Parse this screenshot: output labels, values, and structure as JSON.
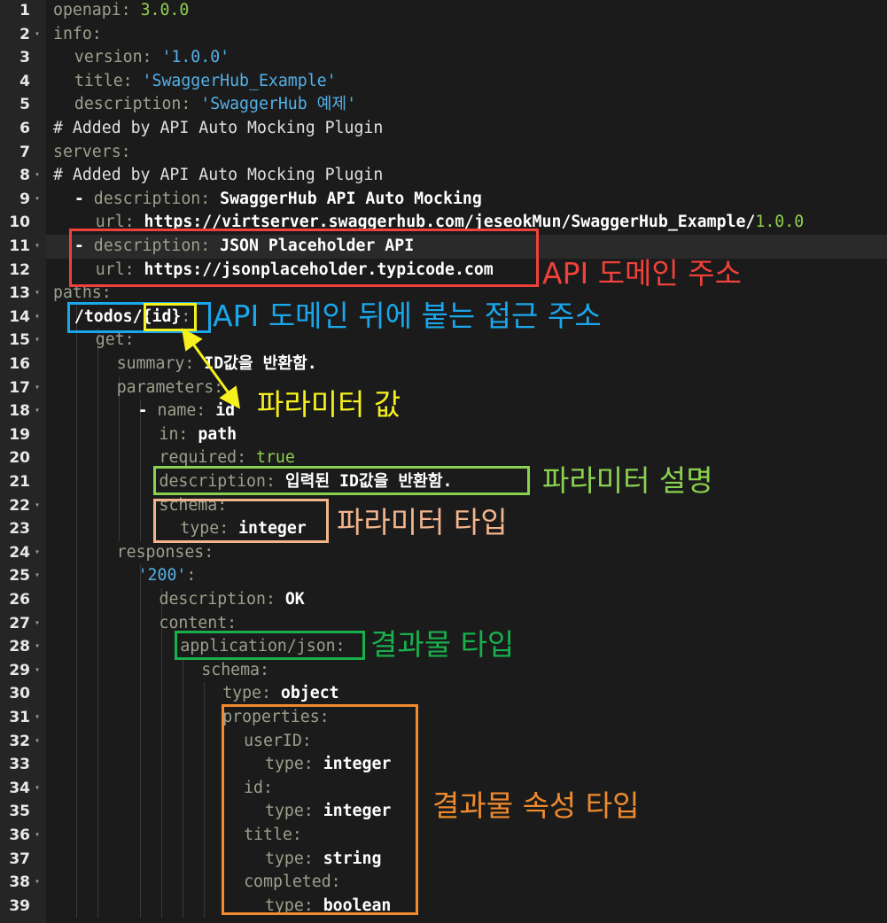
{
  "editor": {
    "lines": [
      {
        "n": "1",
        "indent": 0,
        "fold": false,
        "tokens": [
          [
            "k",
            "openapi: "
          ],
          [
            "n",
            "3.0.0"
          ]
        ]
      },
      {
        "n": "2",
        "indent": 0,
        "fold": true,
        "tokens": [
          [
            "k",
            "info:"
          ]
        ]
      },
      {
        "n": "3",
        "indent": 1,
        "fold": false,
        "tokens": [
          [
            "k",
            "version: "
          ],
          [
            "s",
            "'1.0.0'"
          ]
        ]
      },
      {
        "n": "4",
        "indent": 1,
        "fold": false,
        "tokens": [
          [
            "k",
            "title: "
          ],
          [
            "s",
            "'SwaggerHub_Example'"
          ]
        ]
      },
      {
        "n": "5",
        "indent": 1,
        "fold": false,
        "tokens": [
          [
            "k",
            "description: "
          ],
          [
            "s",
            "'SwaggerHub 예제'"
          ]
        ]
      },
      {
        "n": "6",
        "indent": 0,
        "fold": false,
        "tokens": [
          [
            "c",
            "# Added by API Auto Mocking Plugin"
          ]
        ]
      },
      {
        "n": "7",
        "indent": 0,
        "fold": false,
        "tokens": [
          [
            "k",
            "servers:"
          ]
        ]
      },
      {
        "n": "8",
        "indent": 0,
        "fold": true,
        "tokens": [
          [
            "c",
            "# Added by API Auto Mocking Plugin"
          ]
        ]
      },
      {
        "n": "9",
        "indent": 1,
        "fold": true,
        "tokens": [
          [
            "v",
            "- "
          ],
          [
            "k",
            "description: "
          ],
          [
            "v",
            "SwaggerHub API Auto Mocking"
          ]
        ]
      },
      {
        "n": "10",
        "indent": 2,
        "fold": false,
        "tokens": [
          [
            "k",
            "url: "
          ],
          [
            "v",
            "https://virtserver.swaggerhub.com/jeseokMun/SwaggerHub_Example/"
          ],
          [
            "n",
            "1.0.0"
          ]
        ]
      },
      {
        "n": "11",
        "indent": 1,
        "fold": true,
        "tokens": [
          [
            "v",
            "- "
          ],
          [
            "k",
            "description: "
          ],
          [
            "v",
            "JSON Placeholder API"
          ]
        ]
      },
      {
        "n": "12",
        "indent": 2,
        "fold": false,
        "tokens": [
          [
            "k",
            "url: "
          ],
          [
            "v",
            "https://jsonplaceholder.typicode.com"
          ]
        ]
      },
      {
        "n": "13",
        "indent": 0,
        "fold": true,
        "tokens": [
          [
            "k",
            "paths:"
          ]
        ]
      },
      {
        "n": "14",
        "indent": 1,
        "fold": true,
        "tokens": [
          [
            "v",
            "/todos/{id}"
          ],
          [
            "k",
            ":"
          ]
        ]
      },
      {
        "n": "15",
        "indent": 2,
        "fold": true,
        "tokens": [
          [
            "k",
            "get:"
          ]
        ]
      },
      {
        "n": "16",
        "indent": 3,
        "fold": false,
        "tokens": [
          [
            "k",
            "summary: "
          ],
          [
            "v",
            "ID값을 반환함."
          ]
        ]
      },
      {
        "n": "17",
        "indent": 3,
        "fold": true,
        "tokens": [
          [
            "k",
            "parameters:"
          ]
        ]
      },
      {
        "n": "18",
        "indent": 4,
        "fold": true,
        "tokens": [
          [
            "v",
            "- "
          ],
          [
            "k",
            "name: "
          ],
          [
            "v",
            "id"
          ]
        ]
      },
      {
        "n": "19",
        "indent": 5,
        "fold": false,
        "tokens": [
          [
            "k",
            "in: "
          ],
          [
            "v",
            "path"
          ]
        ]
      },
      {
        "n": "20",
        "indent": 5,
        "fold": false,
        "tokens": [
          [
            "k",
            "required: "
          ],
          [
            "n",
            "true"
          ]
        ]
      },
      {
        "n": "21",
        "indent": 5,
        "fold": false,
        "tokens": [
          [
            "k",
            "description: "
          ],
          [
            "v",
            "입력된 ID값을 반환함."
          ]
        ]
      },
      {
        "n": "22",
        "indent": 5,
        "fold": true,
        "tokens": [
          [
            "k",
            "schema:"
          ]
        ]
      },
      {
        "n": "23",
        "indent": 6,
        "fold": false,
        "tokens": [
          [
            "k",
            "type: "
          ],
          [
            "v",
            "integer"
          ]
        ]
      },
      {
        "n": "24",
        "indent": 3,
        "fold": true,
        "tokens": [
          [
            "k",
            "responses:"
          ]
        ]
      },
      {
        "n": "25",
        "indent": 4,
        "fold": true,
        "tokens": [
          [
            "s",
            "'200'"
          ],
          [
            "k",
            ":"
          ]
        ]
      },
      {
        "n": "26",
        "indent": 5,
        "fold": false,
        "tokens": [
          [
            "k",
            "description: "
          ],
          [
            "v",
            "OK"
          ]
        ]
      },
      {
        "n": "27",
        "indent": 5,
        "fold": true,
        "tokens": [
          [
            "k",
            "content:"
          ]
        ]
      },
      {
        "n": "28",
        "indent": 6,
        "fold": true,
        "tokens": [
          [
            "k",
            "application/json:"
          ]
        ]
      },
      {
        "n": "29",
        "indent": 7,
        "fold": true,
        "tokens": [
          [
            "k",
            "schema:"
          ]
        ]
      },
      {
        "n": "30",
        "indent": 8,
        "fold": false,
        "tokens": [
          [
            "k",
            "type: "
          ],
          [
            "v",
            "object"
          ]
        ]
      },
      {
        "n": "31",
        "indent": 8,
        "fold": true,
        "tokens": [
          [
            "k",
            "properties:"
          ]
        ]
      },
      {
        "n": "32",
        "indent": 9,
        "fold": true,
        "tokens": [
          [
            "k",
            "userID:"
          ]
        ]
      },
      {
        "n": "33",
        "indent": 10,
        "fold": false,
        "tokens": [
          [
            "k",
            "type: "
          ],
          [
            "v",
            "integer"
          ]
        ]
      },
      {
        "n": "34",
        "indent": 9,
        "fold": true,
        "tokens": [
          [
            "k",
            "id:"
          ]
        ]
      },
      {
        "n": "35",
        "indent": 10,
        "fold": false,
        "tokens": [
          [
            "k",
            "type: "
          ],
          [
            "v",
            "integer"
          ]
        ]
      },
      {
        "n": "36",
        "indent": 9,
        "fold": true,
        "tokens": [
          [
            "k",
            "title:"
          ]
        ]
      },
      {
        "n": "37",
        "indent": 10,
        "fold": false,
        "tokens": [
          [
            "k",
            "type: "
          ],
          [
            "v",
            "string"
          ]
        ]
      },
      {
        "n": "38",
        "indent": 9,
        "fold": true,
        "tokens": [
          [
            "k",
            "completed:"
          ]
        ]
      },
      {
        "n": "39",
        "indent": 10,
        "fold": false,
        "tokens": [
          [
            "k",
            "type: "
          ],
          [
            "v",
            "boolean"
          ]
        ]
      }
    ],
    "active_line": "11"
  },
  "annotations": {
    "domain_address": {
      "text": "API 도메인 주소",
      "color": "#f0413a"
    },
    "path_address": {
      "text": "API 도메인 뒤에 붙는 접근 주소",
      "color": "#1aa7ec"
    },
    "param_value": {
      "text": "파라미터 값",
      "color": "#f5f01e"
    },
    "param_desc": {
      "text": "파라미터 설명",
      "color": "#8ad150"
    },
    "param_type": {
      "text": "파라미터 타입",
      "color": "#f2b48c"
    },
    "result_type": {
      "text": "결과물 타입",
      "color": "#18b04c"
    },
    "result_prop_type": {
      "text": "결과물 속성 타입",
      "color": "#f08a2e"
    }
  },
  "colors": {
    "background": "#1b1b1b",
    "gutter": "#252526",
    "key": "#9ba08c",
    "string": "#54b0e6",
    "number": "#8fcf4f",
    "value": "#ffffff"
  }
}
